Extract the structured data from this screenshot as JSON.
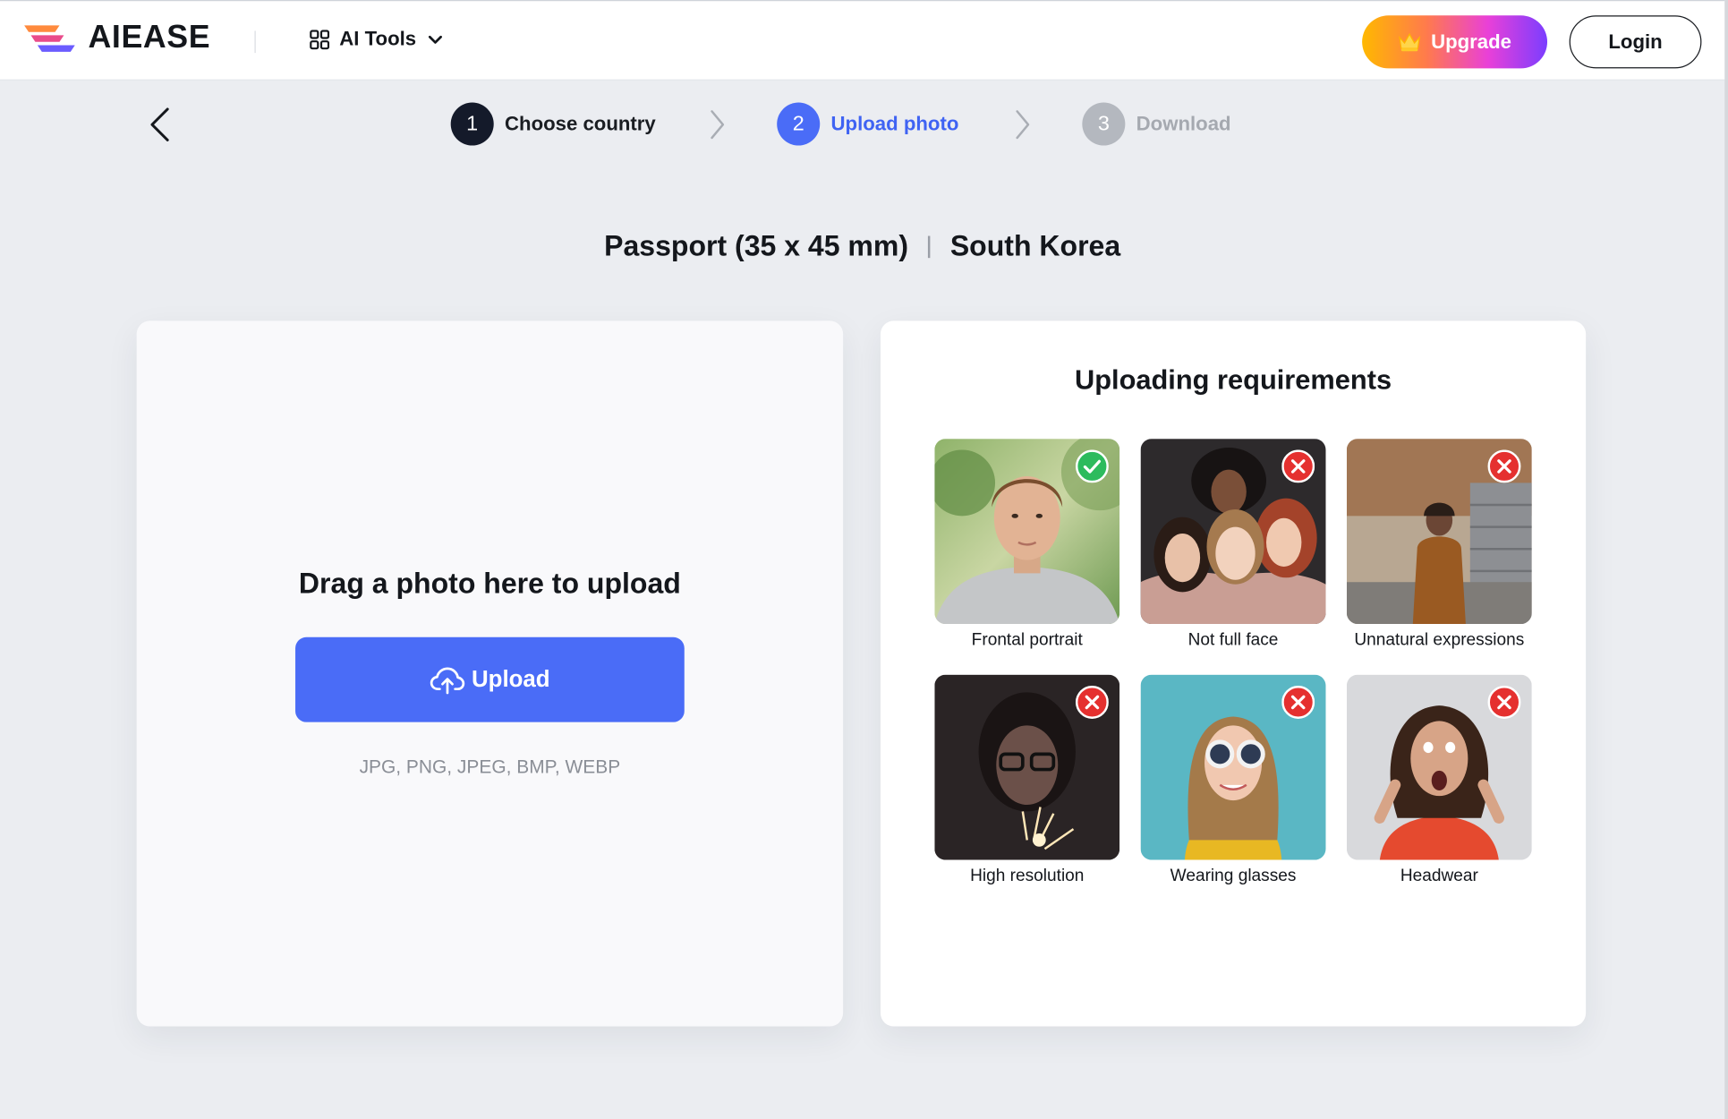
{
  "header": {
    "brand": "AIEASE",
    "tools_label": "AI Tools",
    "upgrade_label": "Upgrade",
    "login_label": "Login"
  },
  "steps": [
    {
      "number": "1",
      "label": "Choose country",
      "state": "done"
    },
    {
      "number": "2",
      "label": "Upload photo",
      "state": "active"
    },
    {
      "number": "3",
      "label": "Download",
      "state": "pending"
    }
  ],
  "document": {
    "size": "Passport (35 x 45 mm)",
    "country": "South Korea"
  },
  "upload": {
    "drag_text": "Drag a photo here to upload",
    "button_label": "Upload",
    "formats": "JPG, PNG, JPEG, BMP, WEBP"
  },
  "requirements": {
    "title": "Uploading requirements",
    "items": [
      {
        "label": "Frontal portrait",
        "status": "check-icon"
      },
      {
        "label": "Not full face",
        "status": "cross-icon"
      },
      {
        "label": "Unnatural expressions",
        "status": "cross-icon"
      },
      {
        "label": "High resolution",
        "status": "cross-icon"
      },
      {
        "label": "Wearing glasses",
        "status": "cross-icon"
      },
      {
        "label": "Headwear",
        "status": "cross-icon"
      }
    ]
  },
  "colors": {
    "accent": "#4a6cf7",
    "ok": "#2dbb5d",
    "error": "#e5302f"
  }
}
